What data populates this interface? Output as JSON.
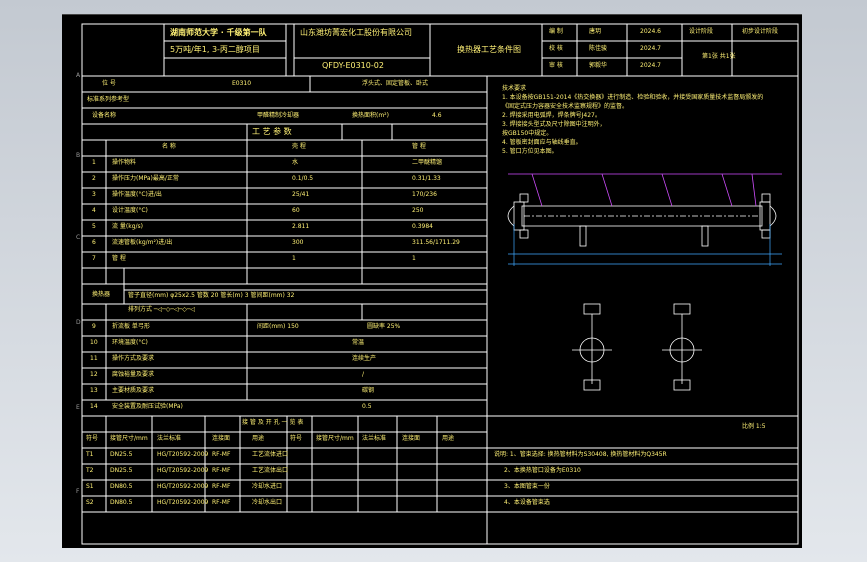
{
  "title_block": {
    "school": "湖南师范大学 · 千级第一队",
    "company": "山东潍坊菁宏化工股份有限公司",
    "project": "5万吨/年1, 3-丙二醇项目",
    "drawing_no": "QFDY-E0310-02",
    "drawing_name": "换热器工艺条件图",
    "design_label": "编  制",
    "check_label": "校  核",
    "audit_label": "审  核",
    "designer": "唐玥",
    "checker": "陈佳骏",
    "auditor": "郭毅华",
    "design_date": "2024.6",
    "check_date": "2024.7",
    "audit_date": "2024.7",
    "stage_label": "设计阶段",
    "stage_value": "初步设计阶段",
    "sheet_info": "第1张  共1张"
  },
  "header_row": {
    "position_label": "位  号",
    "position_value": "E0310",
    "type_value": "浮头式、固定管板、卧式"
  },
  "specs": {
    "section_title": "标准系列参考型",
    "design_label": "设备名称",
    "design_value": "甲醛精制冷却器",
    "area_label": "换热面积(m²)",
    "area_value": "4.6"
  },
  "process": {
    "title": "工 艺 参 数",
    "col_name": "名  称",
    "col_shell": "壳  程",
    "col_tube": "管  程",
    "rows": [
      {
        "no": "1",
        "name": "操作物料",
        "shell": "水",
        "tube": "二甲醚精馏"
      },
      {
        "no": "2",
        "name": "操作压力(MPa)最高/正常",
        "shell": "0.1/0.5",
        "tube": "0.31/1.33"
      },
      {
        "no": "3",
        "name": "操作温度(°C)进/出",
        "shell": "25/41",
        "tube": "170/236"
      },
      {
        "no": "4",
        "name": "设计温度(°C)",
        "shell": "60",
        "tube": "250"
      },
      {
        "no": "5",
        "name": "流  量(kg/s)",
        "shell": "2.811",
        "tube": "0.3984"
      },
      {
        "no": "6",
        "name": "流速管板(kg/m²)进/出",
        "shell": "300",
        "tube": "311.56/1711.29"
      },
      {
        "no": "7",
        "name": "管  程",
        "shell": "1",
        "tube": "1"
      }
    ],
    "exchanger_label": "换热器",
    "tube_info": "管子直径(mm) φ25x2.5    管数 20    管长(m) 3    管间距(mm) 32",
    "arrangement": "排列方式  ─◁─◇─◁─◇─◁",
    "row9": {
      "no": "9",
      "name": "折流板 单弓形",
      "v1": "间距(mm) 150",
      "v2": "圆缺率 25%"
    },
    "row10": {
      "no": "10",
      "name": "环境温度(°C)",
      "value": "常温"
    },
    "row11": {
      "no": "11",
      "name": "操作方式及要求",
      "value": "连续生产"
    },
    "row12": {
      "no": "12",
      "name": "腐蚀裕量及要求",
      "value": "/"
    },
    "row13": {
      "no": "13",
      "name": "主要材质及要求",
      "value": "碳钢"
    },
    "row14": {
      "no": "14",
      "name": "安全装置及耐压试验(MPa)",
      "value": "0.5"
    }
  },
  "nozzle_table": {
    "title": "接 管 及 开 孔 一 览 表",
    "headers": [
      "符号",
      "接管尺寸/mm",
      "法兰标准",
      "连接面",
      "用途",
      "符号",
      "接管尺寸/mm",
      "法兰标准",
      "连接面",
      "用途"
    ],
    "rows": [
      [
        "T1",
        "DN25.5",
        "HG/T20592-2009",
        "RF-MF",
        "工艺流体进口"
      ],
      [
        "T2",
        "DN25.5",
        "HG/T20592-2009",
        "RF-MF",
        "工艺流体出口"
      ],
      [
        "S1",
        "DN80.5",
        "HG/T20592-2009",
        "RF-MF",
        "冷却水进口"
      ],
      [
        "S2",
        "DN80.5",
        "HG/T20592-2009",
        "RF-MF",
        "冷却水出口"
      ]
    ]
  },
  "notes_top": [
    "技术要求",
    "1. 本设备按GB151-2014《热交换器》进行制造、检验和验收，并接受国家质量技术监督局颁发的",
    "   《固定式压力容器安全技术监察规程》的监督。",
    "2. 焊接采用电弧焊，焊条牌号J427。",
    "3. 焊接接头型式及尺寸除图中注明外，",
    "   按GB150中规定。",
    "4. 管板密封面应与轴线垂直。",
    "5. 管口方位见本图。"
  ],
  "scale": "比例 1:5",
  "bottom_notes": [
    "说明: 1、管束选择: 换热管材料为S30408, 换热管材料为Q345R",
    "2、本换热管口设备为E0310",
    "3、本图管束一份",
    "4、本设备管束选"
  ],
  "grid_letters": [
    "A",
    "B",
    "C",
    "D",
    "E",
    "F"
  ]
}
